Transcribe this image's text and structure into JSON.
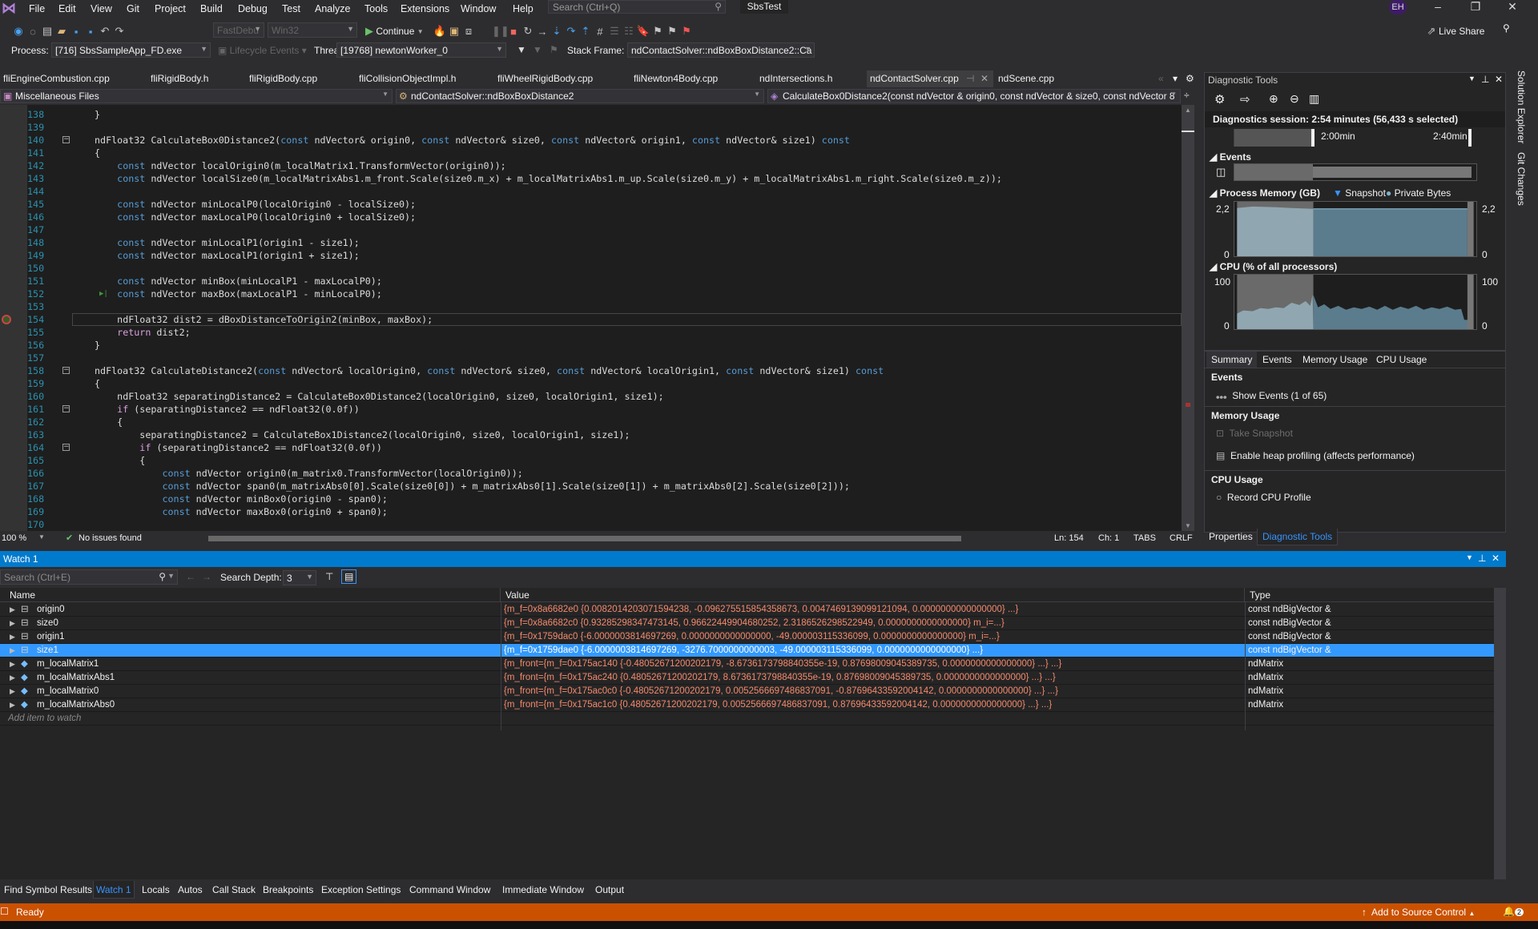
{
  "menu": {
    "items": [
      "File",
      "Edit",
      "View",
      "Git",
      "Project",
      "Build",
      "Debug",
      "Test",
      "Analyze",
      "Tools",
      "Extensions",
      "Window",
      "Help"
    ],
    "search_placeholder": "Search (Ctrl+Q)",
    "solution": "SbsTest",
    "user_initials": "EH"
  },
  "toolbar": {
    "config": "FastDebu",
    "platform": "Win32",
    "continue_label": "Continue",
    "live_share": "Live Share"
  },
  "debugbar": {
    "process_label": "Process:",
    "process": "[716] SbsSampleApp_FD.exe",
    "lifecycle": "Lifecycle Events",
    "thread_label": "Thread:",
    "thread": "[19768] newtonWorker_0",
    "stack_label": "Stack Frame:",
    "stack": "ndContactSolver::ndBoxBoxDistance2::Ca"
  },
  "tabs": [
    {
      "label": "fliEngineCombustion.cpp"
    },
    {
      "label": "fliRigidBody.h"
    },
    {
      "label": "fliRigidBody.cpp"
    },
    {
      "label": "fliCollisionObjectImpl.h"
    },
    {
      "label": "fliWheelRigidBody.cpp"
    },
    {
      "label": "fliNewton4Body.cpp"
    },
    {
      "label": "ndIntersections.h"
    },
    {
      "label": "ndContactSolver.cpp",
      "active": true
    },
    {
      "label": "ndScene.cpp"
    }
  ],
  "navbar": {
    "project": "Miscellaneous Files",
    "scope": "ndContactSolver::ndBoxBoxDistance2",
    "member": "CalculateBox0Distance2(const ndVector & origin0, const ndVector & size0, const ndVector 8"
  },
  "editor": {
    "current_line": 154,
    "lines": [
      {
        "n": 138,
        "code": "}"
      },
      {
        "n": 139,
        "code": ""
      },
      {
        "n": 140,
        "code": "ndFloat32 CalculateBox0Distance2(const ndVector& origin0, const ndVector& size0, const ndVector& origin1, const ndVector& size1) const",
        "fold": true
      },
      {
        "n": 141,
        "code": "{"
      },
      {
        "n": 142,
        "code": "\tconst ndVector localOrigin0(m_localMatrix1.TransformVector(origin0));"
      },
      {
        "n": 143,
        "code": "\tconst ndVector localSize0(m_localMatrixAbs1.m_front.Scale(size0.m_x) + m_localMatrixAbs1.m_up.Scale(size0.m_y) + m_localMatrixAbs1.m_right.Scale(size0.m_z));"
      },
      {
        "n": 144,
        "code": ""
      },
      {
        "n": 145,
        "code": "\tconst ndVector minLocalP0(localOrigin0 - localSize0);"
      },
      {
        "n": 146,
        "code": "\tconst ndVector maxLocalP0(localOrigin0 + localSize0);"
      },
      {
        "n": 147,
        "code": ""
      },
      {
        "n": 148,
        "code": "\tconst ndVector minLocalP1(origin1 - size1);"
      },
      {
        "n": 149,
        "code": "\tconst ndVector maxLocalP1(origin1 + size1);"
      },
      {
        "n": 150,
        "code": ""
      },
      {
        "n": 151,
        "code": "\tconst ndVector minBox(minLocalP1 - maxLocalP0);"
      },
      {
        "n": 152,
        "code": "\tconst ndVector maxBox(maxLocalP1 - minLocalP0);"
      },
      {
        "n": 153,
        "code": ""
      },
      {
        "n": 154,
        "code": "\tndFloat32 dist2 = dBoxDistanceToOrigin2(minBox, maxBox);"
      },
      {
        "n": 155,
        "code": "\treturn dist2;"
      },
      {
        "n": 156,
        "code": "}"
      },
      {
        "n": 157,
        "code": ""
      },
      {
        "n": 158,
        "code": "ndFloat32 CalculateDistance2(const ndVector& localOrigin0, const ndVector& size0, const ndVector& localOrigin1, const ndVector& size1) const",
        "fold": true
      },
      {
        "n": 159,
        "code": "{"
      },
      {
        "n": 160,
        "code": "\tndFloat32 separatingDistance2 = CalculateBox0Distance2(localOrigin0, size0, localOrigin1, size1);"
      },
      {
        "n": 161,
        "code": "\tif (separatingDistance2 == ndFloat32(0.0f))",
        "fold": true
      },
      {
        "n": 162,
        "code": "\t{"
      },
      {
        "n": 163,
        "code": "\t\tseparatingDistance2 = CalculateBox1Distance2(localOrigin0, size0, localOrigin1, size1);"
      },
      {
        "n": 164,
        "code": "\t\tif (separatingDistance2 == ndFloat32(0.0f))",
        "fold": true
      },
      {
        "n": 165,
        "code": "\t\t{"
      },
      {
        "n": 166,
        "code": "\t\t\tconst ndVector origin0(m_matrix0.TransformVector(localOrigin0));"
      },
      {
        "n": 167,
        "code": "\t\t\tconst ndVector span0(m_matrixAbs0[0].Scale(size0[0]) + m_matrixAbs0[1].Scale(size0[1]) + m_matrixAbs0[2].Scale(size0[2]));"
      },
      {
        "n": 168,
        "code": "\t\t\tconst ndVector minBox0(origin0 - span0);"
      },
      {
        "n": 169,
        "code": "\t\t\tconst ndVector maxBox0(origin0 + span0);"
      },
      {
        "n": 170,
        "code": ""
      }
    ]
  },
  "editor_status": {
    "zoom": "100 %",
    "issues": "No issues found",
    "line": "Ln: 154",
    "col": "Ch: 1",
    "tabs": "TABS",
    "eol": "CRLF"
  },
  "diagnostics": {
    "title": "Diagnostic Tools",
    "session": "Diagnostics session: 2:54 minutes (56,433 s selected)",
    "ticks": [
      "2:00min",
      "2:40min"
    ],
    "events_label": "Events",
    "memory_label": "Process Memory (GB)",
    "legend": [
      "Snapshot",
      "Private Bytes"
    ],
    "memory_max": "2,2",
    "memory_min": "0",
    "cpu_label": "CPU (% of all processors)",
    "cpu_max": "100",
    "cpu_min": "0",
    "tabs": [
      "Summary",
      "Events",
      "Memory Usage",
      "CPU Usage"
    ],
    "sections": {
      "events": "Events",
      "show_events": "Show Events (1 of 65)",
      "memory": "Memory Usage",
      "take_snapshot": "Take Snapshot",
      "heap": "Enable heap profiling (affects performance)",
      "cpu": "CPU Usage",
      "record_cpu": "Record CPU Profile"
    },
    "bottom_tabs": [
      "Properties",
      "Diagnostic Tools"
    ]
  },
  "side_tabs": [
    "Solution Explorer",
    "Git Changes"
  ],
  "watch": {
    "title": "Watch 1",
    "search_placeholder": "Search (Ctrl+E)",
    "depth_label": "Search Depth:",
    "depth": "3",
    "columns": [
      "Name",
      "Value",
      "Type"
    ],
    "rows": [
      {
        "name": "origin0",
        "value": "{m_f=0x8a6682e0 {0.0082014203071594238, -0.096275515854358673, 0.0047469139099121094, 0.0000000000000000} ...}",
        "type": "const ndBigVector &",
        "icon": "variable"
      },
      {
        "name": "size0",
        "value": "{m_f=0x8a6682c0 {0.93285298347473145, 0.96622449904680252, 2.3186526298522949, 0.0000000000000000} m_i=...}",
        "type": "const ndBigVector &",
        "icon": "variable"
      },
      {
        "name": "origin1",
        "value": "{m_f=0x1759dac0 {-6.0000003814697269, 0.0000000000000000, -49.000003115336099, 0.0000000000000000} m_i=...}",
        "type": "const ndBigVector &",
        "icon": "variable"
      },
      {
        "name": "size1",
        "value": "{m_f=0x1759dae0 {-6.0000003814697269, -3276.7000000000003, -49.000003115336099, 0.0000000000000000} ...}",
        "type": "const ndBigVector &",
        "icon": "variable",
        "selected": true
      },
      {
        "name": "m_localMatrix1",
        "value": "{m_front={m_f=0x175ac140 {-0.48052671200202179, -8.6736173798840355e-19, 0.87698009045389735, 0.0000000000000000} ...} ...}",
        "type": "ndMatrix",
        "icon": "field"
      },
      {
        "name": "m_localMatrixAbs1",
        "value": "{m_front={m_f=0x175ac240 {0.48052671200202179, 8.6736173798840355e-19, 0.87698009045389735, 0.0000000000000000} ...} ...}",
        "type": "ndMatrix",
        "icon": "field"
      },
      {
        "name": "m_localMatrix0",
        "value": "{m_front={m_f=0x175ac0c0 {-0.48052671200202179, 0.0052566697486837091, -0.87696433592004142, 0.0000000000000000} ...} ...}",
        "type": "ndMatrix",
        "icon": "field"
      },
      {
        "name": "m_localMatrixAbs0",
        "value": "{m_front={m_f=0x175ac1c0 {0.48052671200202179, 0.0052566697486837091, 0.87696433592004142, 0.0000000000000000} ...} ...}",
        "type": "ndMatrix",
        "icon": "field"
      }
    ],
    "add_placeholder": "Add item to watch"
  },
  "bottom_tabs": [
    {
      "label": "Find Symbol Results"
    },
    {
      "label": "Watch 1",
      "active": true
    },
    {
      "label": "Locals"
    },
    {
      "label": "Autos"
    },
    {
      "label": "Call Stack"
    },
    {
      "label": "Breakpoints"
    },
    {
      "label": "Exception Settings"
    },
    {
      "label": "Command Window"
    },
    {
      "label": "Immediate Window"
    },
    {
      "label": "Output"
    }
  ],
  "statusbar": {
    "ready": "Ready",
    "source_control": "Add to Source Control",
    "notifications": "2",
    "color": "#ca5100"
  },
  "colors": {
    "accent": "#007acc",
    "keyword": "#569cd6",
    "control_keyword": "#d8a0df",
    "number": "#b5cea8",
    "line_number": "#2b91af",
    "changed_value": "#f48a6b",
    "selection": "#3399ff"
  }
}
